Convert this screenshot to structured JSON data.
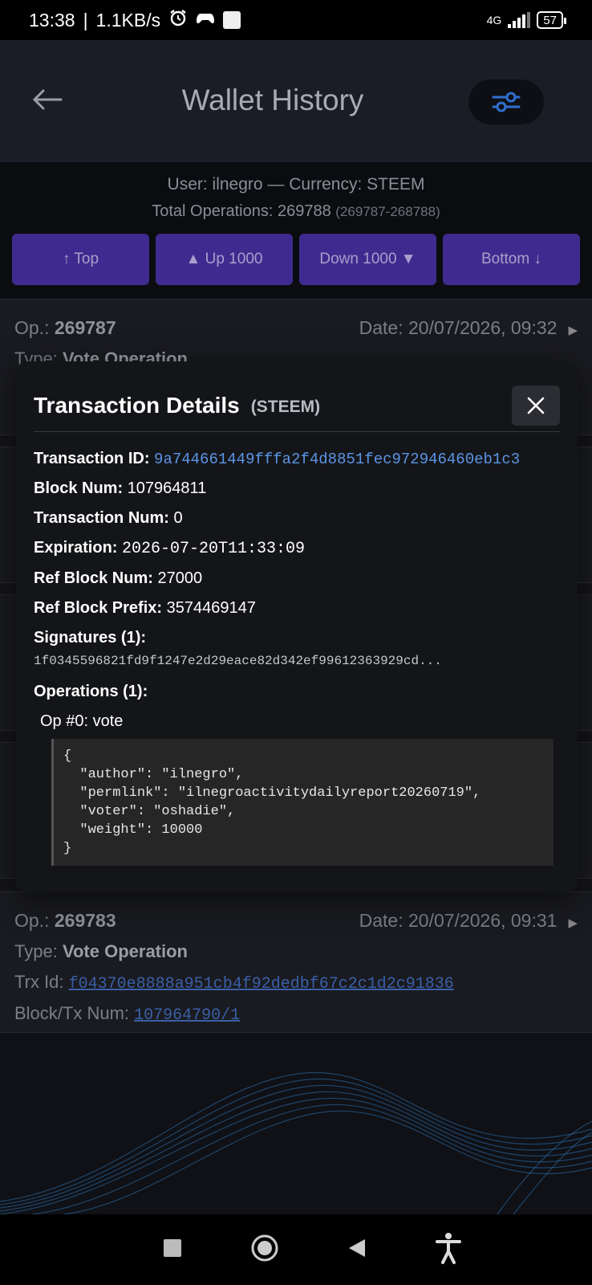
{
  "status": {
    "time": "13:38",
    "speed": "1.1KB/s",
    "network": "4G",
    "battery": "57"
  },
  "header": {
    "title": "Wallet History"
  },
  "info": {
    "user_line": "User: ilnegro — Currency: STEEM",
    "total_line": "Total Operations: 269788",
    "range": "(269787-268788)"
  },
  "nav": {
    "top": "↑ Top",
    "up": "▲ Up 1000",
    "down": "Down 1000 ▼",
    "bottom": "Bottom ↓"
  },
  "list": {
    "op_label": "Op.:",
    "date_label": "Date:",
    "type_label": "Type:",
    "trx_label": "Trx Id:",
    "block_label": "Block/Tx Num:",
    "items": [
      {
        "op": "269787",
        "date": "20/07/2026, 09:32",
        "type": "Vote Operation"
      },
      {
        "op": "269783",
        "date": "20/07/2026, 09:31",
        "type": "Vote Operation",
        "trx": "f04370e8888a951cb4f92dedbf67c2c1d2c91836",
        "block": "107964790/1"
      }
    ]
  },
  "modal": {
    "title": "Transaction Details",
    "currency": "(STEEM)",
    "txid_label": "Transaction ID:",
    "txid": "9a744661449fffa2f4d8851fec972946460eb1c3",
    "block_label": "Block Num:",
    "block": "107964811",
    "txnum_label": "Transaction Num:",
    "txnum": "0",
    "exp_label": "Expiration:",
    "exp": "2026-07-20T11:33:09",
    "refblock_label": "Ref Block Num:",
    "refblock": "27000",
    "prefix_label": "Ref Block Prefix:",
    "prefix": "3574469147",
    "sig_label": "Signatures (1):",
    "sig": "1f0345596821fd9f1247e2d29eace82d342ef99612363929cd...",
    "ops_label": "Operations (1):",
    "op0_label": "Op #0: vote",
    "op0_json": "{\n  \"author\": \"ilnegro\",\n  \"permlink\": \"ilnegroactivitydailyreport20260719\",\n  \"voter\": \"oshadie\",\n  \"weight\": 10000\n}"
  },
  "colors": {
    "accent": "#3f2b8f",
    "link": "#5b95e6",
    "filter": "#2f6fcf"
  }
}
